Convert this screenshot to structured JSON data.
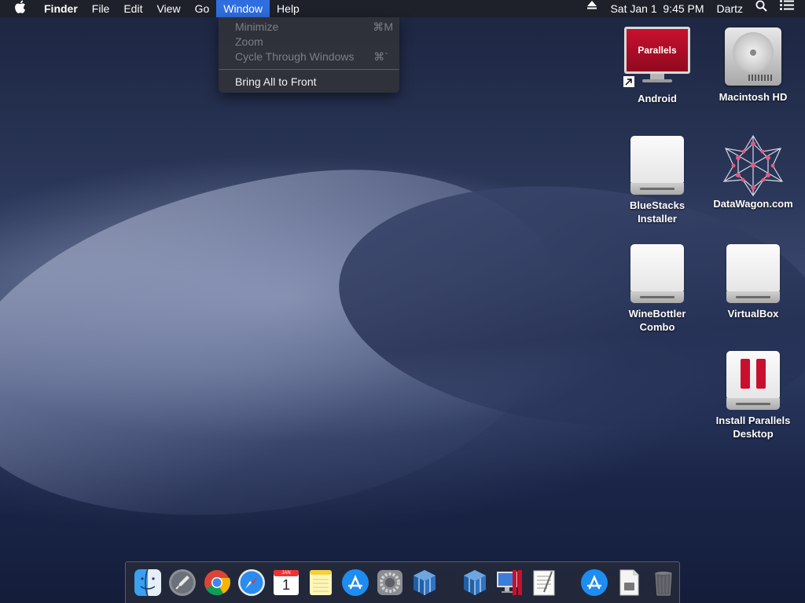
{
  "menubar": {
    "apple_icon": "apple-logo-icon",
    "app_name": "Finder",
    "menus": [
      "File",
      "Edit",
      "View",
      "Go",
      "Window",
      "Help"
    ],
    "active_menu": "Window",
    "clock": "Sat Jan 1  9:45 PM",
    "user": "Dartz",
    "status_icons": [
      "eject-icon",
      "spotlight-search-icon",
      "notification-center-icon"
    ]
  },
  "window_menu": {
    "items": [
      {
        "label": "Minimize",
        "shortcut": "⌘M",
        "enabled": false
      },
      {
        "label": "Zoom",
        "shortcut": "",
        "enabled": false
      },
      {
        "label": "Cycle Through Windows",
        "shortcut": "⌘`",
        "enabled": false
      },
      {
        "label": "Bring All to Front",
        "shortcut": "",
        "enabled": true
      }
    ]
  },
  "desktop_icons": [
    {
      "label": "Android",
      "icon": "parallels-vm-icon"
    },
    {
      "label": "Macintosh HD",
      "icon": "hard-drive-icon"
    },
    {
      "label": "BlueStacks Installer",
      "icon": "disk-image-icon"
    },
    {
      "label": "DataWagon.com",
      "icon": "datawagon-icon"
    },
    {
      "label": "WineBottler Combo",
      "icon": "disk-image-icon"
    },
    {
      "label": "VirtualBox",
      "icon": "disk-image-icon"
    },
    {
      "label": "Install Parallels Desktop",
      "icon": "parallels-installer-icon"
    }
  ],
  "parallels_screen_text": "Parallels",
  "calendar_date": "1",
  "calendar_month": "JAN",
  "dock": {
    "apps": [
      "finder",
      "launchpad",
      "chrome",
      "safari",
      "calendar",
      "notes",
      "app-store",
      "system-preferences",
      "virtualbox"
    ],
    "recent": [
      "virtualbox",
      "parallels-desktop",
      "textedit"
    ],
    "others": [
      "app-store-downloads",
      "documents",
      "trash"
    ]
  },
  "colors": {
    "menu_highlight": "#2f6ee0",
    "parallels_red": "#c8102e",
    "datawagon_pink": "#e05a86"
  }
}
